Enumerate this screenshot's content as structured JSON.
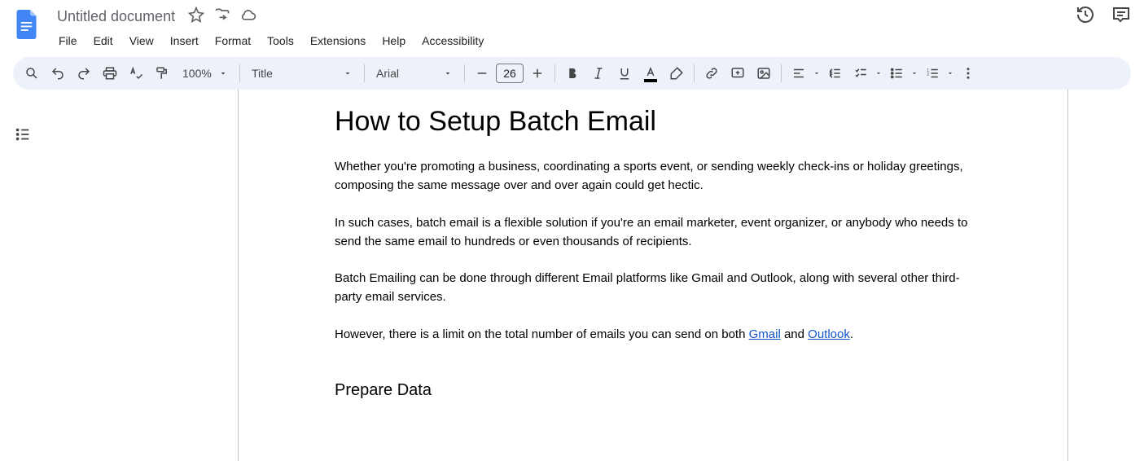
{
  "header": {
    "doc_title": "Untitled document",
    "menus": [
      "File",
      "Edit",
      "View",
      "Insert",
      "Format",
      "Tools",
      "Extensions",
      "Help",
      "Accessibility"
    ]
  },
  "toolbar": {
    "zoom": "100%",
    "paragraph_style": "Title",
    "font_family": "Arial",
    "font_size": "26"
  },
  "document": {
    "title": "How to Setup Batch Email",
    "paragraphs": [
      "Whether you're promoting a business, coordinating a sports event, or sending weekly check-ins or holiday greetings, composing the same message over and over again could get hectic.",
      "In such cases, batch email is a flexible solution if you're an email marketer, event organizer, or anybody who needs to send the same email to hundreds or even thousands of recipients.",
      "Batch Emailing can be done through different Email platforms like Gmail and Outlook, along with several other third-party email services."
    ],
    "p4_parts": {
      "a": "However, there is a limit on the total number of emails you can send on both ",
      "link1": "Gmail",
      "b": " and ",
      "link2": "Outlook",
      "c": "."
    },
    "h2": "Prepare Data"
  }
}
